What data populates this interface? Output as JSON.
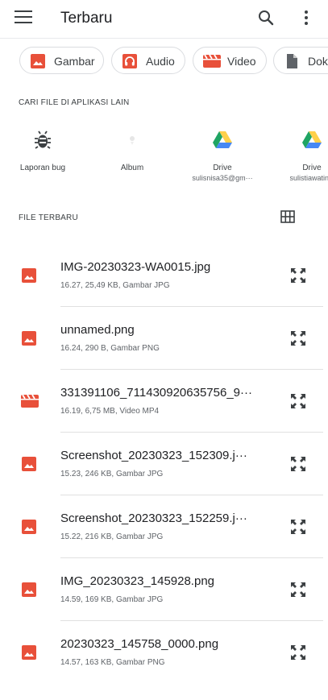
{
  "appbar": {
    "title": "Terbaru"
  },
  "chips": [
    {
      "label": "Gambar",
      "icon": "image-icon"
    },
    {
      "label": "Audio",
      "icon": "headphones-icon"
    },
    {
      "label": "Video",
      "icon": "video-icon"
    },
    {
      "label": "Dokumen",
      "icon": "document-icon"
    }
  ],
  "sections": {
    "other_apps": "CARI FILE DI APLIKASI LAIN",
    "recent_files": "FILE TERBARU"
  },
  "apps": [
    {
      "name": "Laporan bug",
      "sub": "",
      "icon": "bug-icon"
    },
    {
      "name": "Album",
      "sub": "",
      "icon": "album-icon"
    },
    {
      "name": "Drive",
      "sub": "sulisnisa35@gm···",
      "icon": "google-drive-icon"
    },
    {
      "name": "Drive",
      "sub": "sulistiawatinis",
      "icon": "google-drive-icon"
    }
  ],
  "files": [
    {
      "name": "IMG-20230323-WA0015.jpg",
      "meta": "16.27, 25,49 KB, Gambar JPG",
      "icon": "image-icon"
    },
    {
      "name": "unnamed.png",
      "meta": "16.24, 290 B, Gambar PNG",
      "icon": "image-icon"
    },
    {
      "name": "331391106_711430920635756_9···",
      "meta": "16.19, 6,75 MB, Video MP4",
      "icon": "video-icon"
    },
    {
      "name": "Screenshot_20230323_152309.j···",
      "meta": "15.23, 246 KB, Gambar JPG",
      "icon": "image-icon"
    },
    {
      "name": "Screenshot_20230323_152259.j···",
      "meta": "15.22, 216 KB, Gambar JPG",
      "icon": "image-icon"
    },
    {
      "name": "IMG_20230323_145928.png",
      "meta": "14.59, 169 KB, Gambar JPG",
      "icon": "image-icon"
    },
    {
      "name": "20230323_145758_0000.png",
      "meta": "14.57, 163 KB, Gambar PNG",
      "icon": "image-icon"
    }
  ],
  "colors": {
    "accent_red": "#e8503a",
    "drive_green": "#1fa463",
    "drive_yellow": "#ffd04b",
    "drive_blue": "#4688f4"
  }
}
